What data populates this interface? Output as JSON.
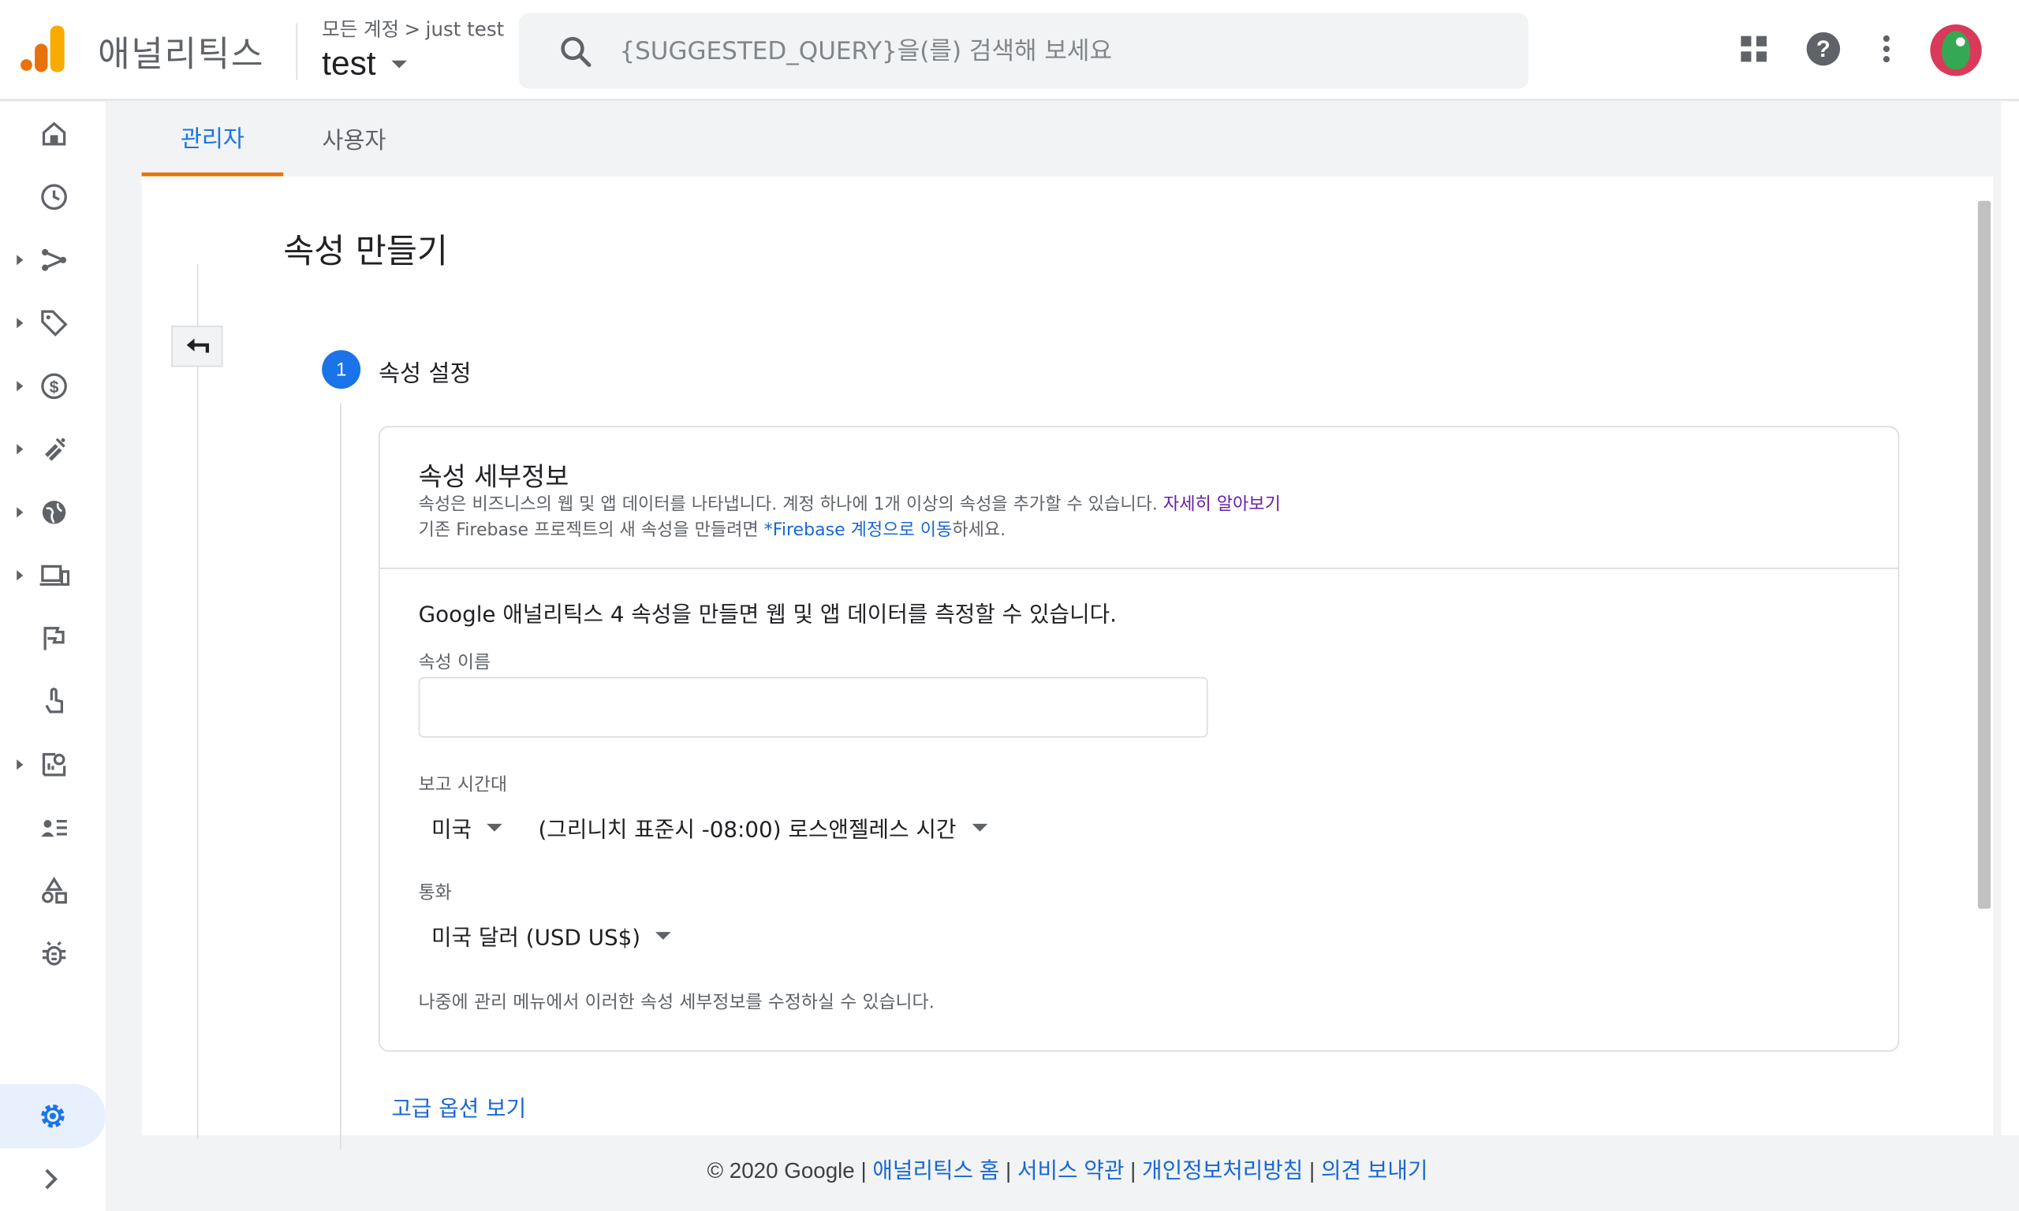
{
  "app": {
    "title": "애널리틱스"
  },
  "breadcrumb": {
    "root": "모든 계정",
    "separator": ">",
    "account": "just test"
  },
  "property_selector": {
    "value": "test"
  },
  "search": {
    "placeholder": "{SUGGESTED_QUERY}을(를) 검색해 보세요"
  },
  "header_icons": [
    "apps-grid-icon",
    "help-icon",
    "more-vert-icon",
    "avatar"
  ],
  "tabs": [
    {
      "label": "관리자",
      "active": true
    },
    {
      "label": "사용자",
      "active": false
    }
  ],
  "page": {
    "title": "속성 만들기"
  },
  "step": {
    "number": "1",
    "label": "속성 설정"
  },
  "card": {
    "title": "속성 세부정보",
    "desc_line1": "속성은 비즈니스의 웹 및 앱 데이터를 나타냅니다. 계정 하나에 1개 이상의 속성을 추가할 수 있습니다.",
    "learn_more": "자세히 알아보기",
    "desc_line2_prefix": "기존 Firebase 프로젝트의 새 속성을 만들려면 ",
    "firebase_link": "*Firebase 계정으로 이동",
    "desc_line2_suffix": "하세요.",
    "intro": "Google 애널리틱스 4 속성을 만들면 웹 및 앱 데이터를 측정할 수 있습니다.",
    "name_label": "속성 이름",
    "name_value": "",
    "timezone_label": "보고 시간대",
    "country": "미국",
    "timezone": "(그리니치 표준시 -08:00) 로스앤젤레스 시간",
    "currency_label": "통화",
    "currency": "미국 달러 (USD US$)",
    "note": "나중에 관리 메뉴에서 이러한 속성 세부정보를 수정하실 수 있습니다."
  },
  "advanced_link": "고급 옵션 보기",
  "footer": {
    "copyright": "© 2020 Google",
    "sep": " | ",
    "links": [
      "애널리틱스 홈",
      "서비스 약관",
      "개인정보처리방침",
      "의견 보내기"
    ]
  },
  "colors": {
    "accent": "#1a73e8",
    "tab_indicator": "#e8710a",
    "logo_orange": "#e8710a",
    "logo_yellow": "#f9ab00"
  }
}
